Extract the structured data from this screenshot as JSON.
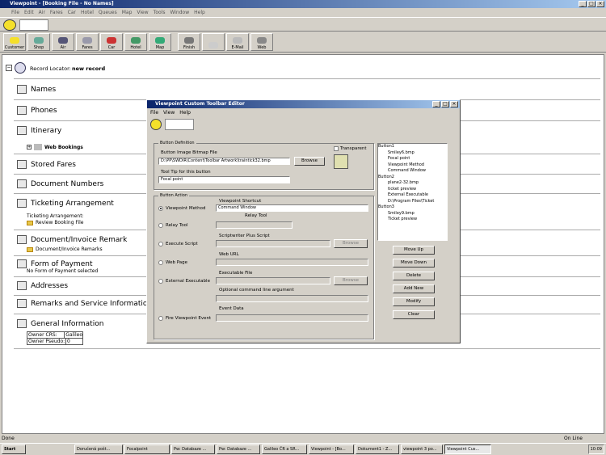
{
  "app": {
    "title": "Viewpoint - [Booking File - No Names]"
  },
  "menu": [
    "File",
    "Edit",
    "Air",
    "Fares",
    "Car",
    "Hotel",
    "Queues",
    "Map",
    "View",
    "Tools",
    "Window",
    "Help"
  ],
  "toolbar": [
    "Customer",
    "Shop",
    "Air",
    "Fares",
    "Car",
    "Hotel",
    "Map",
    "Finish",
    "",
    "E-Mail",
    "Web"
  ],
  "record": {
    "label": "Record Locator:",
    "value": "new record"
  },
  "sections": [
    "Names",
    "Phones",
    "Itinerary",
    "Stored Fares",
    "Document Numbers",
    "Ticketing Arrangement",
    "Document/Invoice Remark",
    "Form of Payment",
    "Addresses",
    "Remarks and Service Informatio",
    "General Information"
  ],
  "subs": {
    "web_bookings": "Web Bookings",
    "ticketing_arr": "Ticketing Arrangement:",
    "review_booking": "Review Booking File",
    "doc_invoice": "Document/Invoice Remarks",
    "no_fop": "No Form of Payment selected"
  },
  "general": {
    "owner_crs_label": "Owner CRS:",
    "owner_crs": "Galileo",
    "owner_pseudo_label": "Owner Pseudo:",
    "owner_pseudo": "0"
  },
  "dialog": {
    "title": "Viewpoint Custom Toolbar Editor",
    "menu": [
      "File",
      "View",
      "Help"
    ],
    "button_definition": "Button Definition",
    "bitmap_label": "Button Image Bitmap File",
    "bitmap_value": "D:\\PP\\SWDIR\\Content\\Toolbar Artwork\\traintick32.bmp",
    "browse": "Browse",
    "transparent": "Transparent",
    "tooltip_label": "Tool Tip for this button",
    "tooltip_value": "Focal point",
    "button_action": "Button Action",
    "vp_shortcut": "Viewpoint Shortcut",
    "vp_method": "Viewpoint Method",
    "vp_method_value": "Command Window",
    "relay_tool_hdr": "Relay Tool",
    "relay_tool": "Relay Tool",
    "sw_script_hdr": "Scriptwriter Plus Script",
    "exec_script": "Execute  Script",
    "web_url_hdr": "Web URL",
    "web_page": "Web Page",
    "exe_file_hdr": "Executable File",
    "external_exe": "External Executable",
    "opt_cmd": "Optional command line argument",
    "event_data": "Event Data",
    "fire_event": "Fire Viewpoint Event",
    "browse2": "Browse",
    "browse3": "Browse",
    "tree": [
      "Button1",
      "Smiley6.bmp",
      "Focal point",
      "Viewpoint Method",
      "Command Window",
      "Button2",
      "plane2-32.bmp",
      "ticket preview",
      "External Executable",
      "D:\\Program Files\\Ticket",
      "Button3",
      "Smiley9.bmp",
      "Ticket preview"
    ],
    "buttons": [
      "Move Up",
      "Move Down",
      "Delete",
      "Add New",
      "Modify",
      "Clear"
    ]
  },
  "status": {
    "left": "Done",
    "right": "On Line"
  },
  "taskbar": [
    "Start",
    "Doručená pošt...",
    "Focalpoint",
    "Pw: Databaze ...",
    "Pw: Databaze ...",
    "Galileo ČR a SR...",
    "Viewpoint - [Bo...",
    "Dokument1 - Z...",
    "viewpoint 3 po...",
    "Viewpoint Cus..."
  ],
  "clock": "10:09"
}
